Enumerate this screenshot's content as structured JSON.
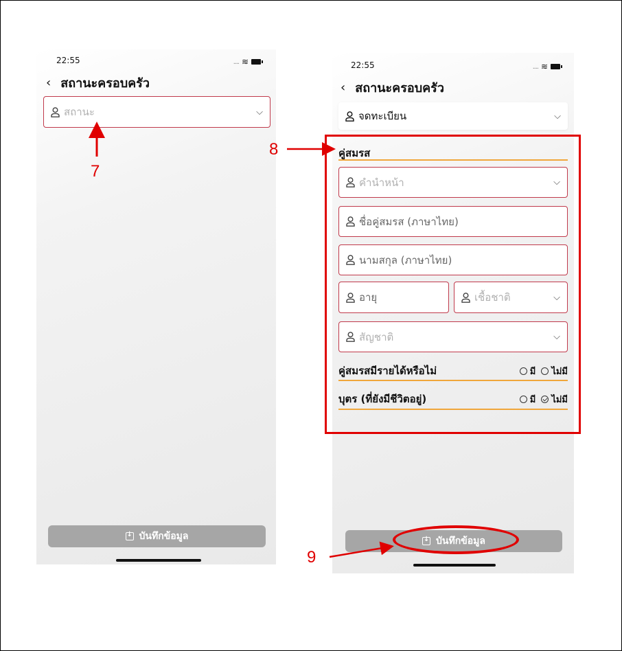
{
  "screen1": {
    "time": "22:55",
    "title": "สถานะครอบครัว",
    "status_field": {
      "placeholder": "สถานะ"
    },
    "save_label": "บันทึกข้อมูล"
  },
  "screen2": {
    "time": "22:55",
    "title": "สถานะครอบครัว",
    "status_field": {
      "value": "จดทะเบียน"
    },
    "spouse_section_title": "คู่สมรส",
    "prefix_placeholder": "คำนำหน้า",
    "spouse_name_placeholder": "ชื่อคู่สมรส (ภาษาไทย)",
    "surname_placeholder": "นามสกุล (ภาษาไทย)",
    "age_placeholder": "อายุ",
    "ethnicity_placeholder": "เชื้อชาติ",
    "nationality_placeholder": "สัญชาติ",
    "income_question": "คู่สมรสมีรายได้หรือไม่",
    "children_question": "บุตร (ที่ยังมีชีวิตอยู่)",
    "option_yes": "มี",
    "option_no": "ไม่มี",
    "save_label": "บันทึกข้อมูล"
  },
  "annotations": {
    "label_7": "7",
    "label_8": "8",
    "label_9": "9"
  },
  "colors": {
    "annotation": "#e00000",
    "field_border": "#c0394b",
    "underline": "#f0a63a",
    "button": "#a6a6a6"
  }
}
